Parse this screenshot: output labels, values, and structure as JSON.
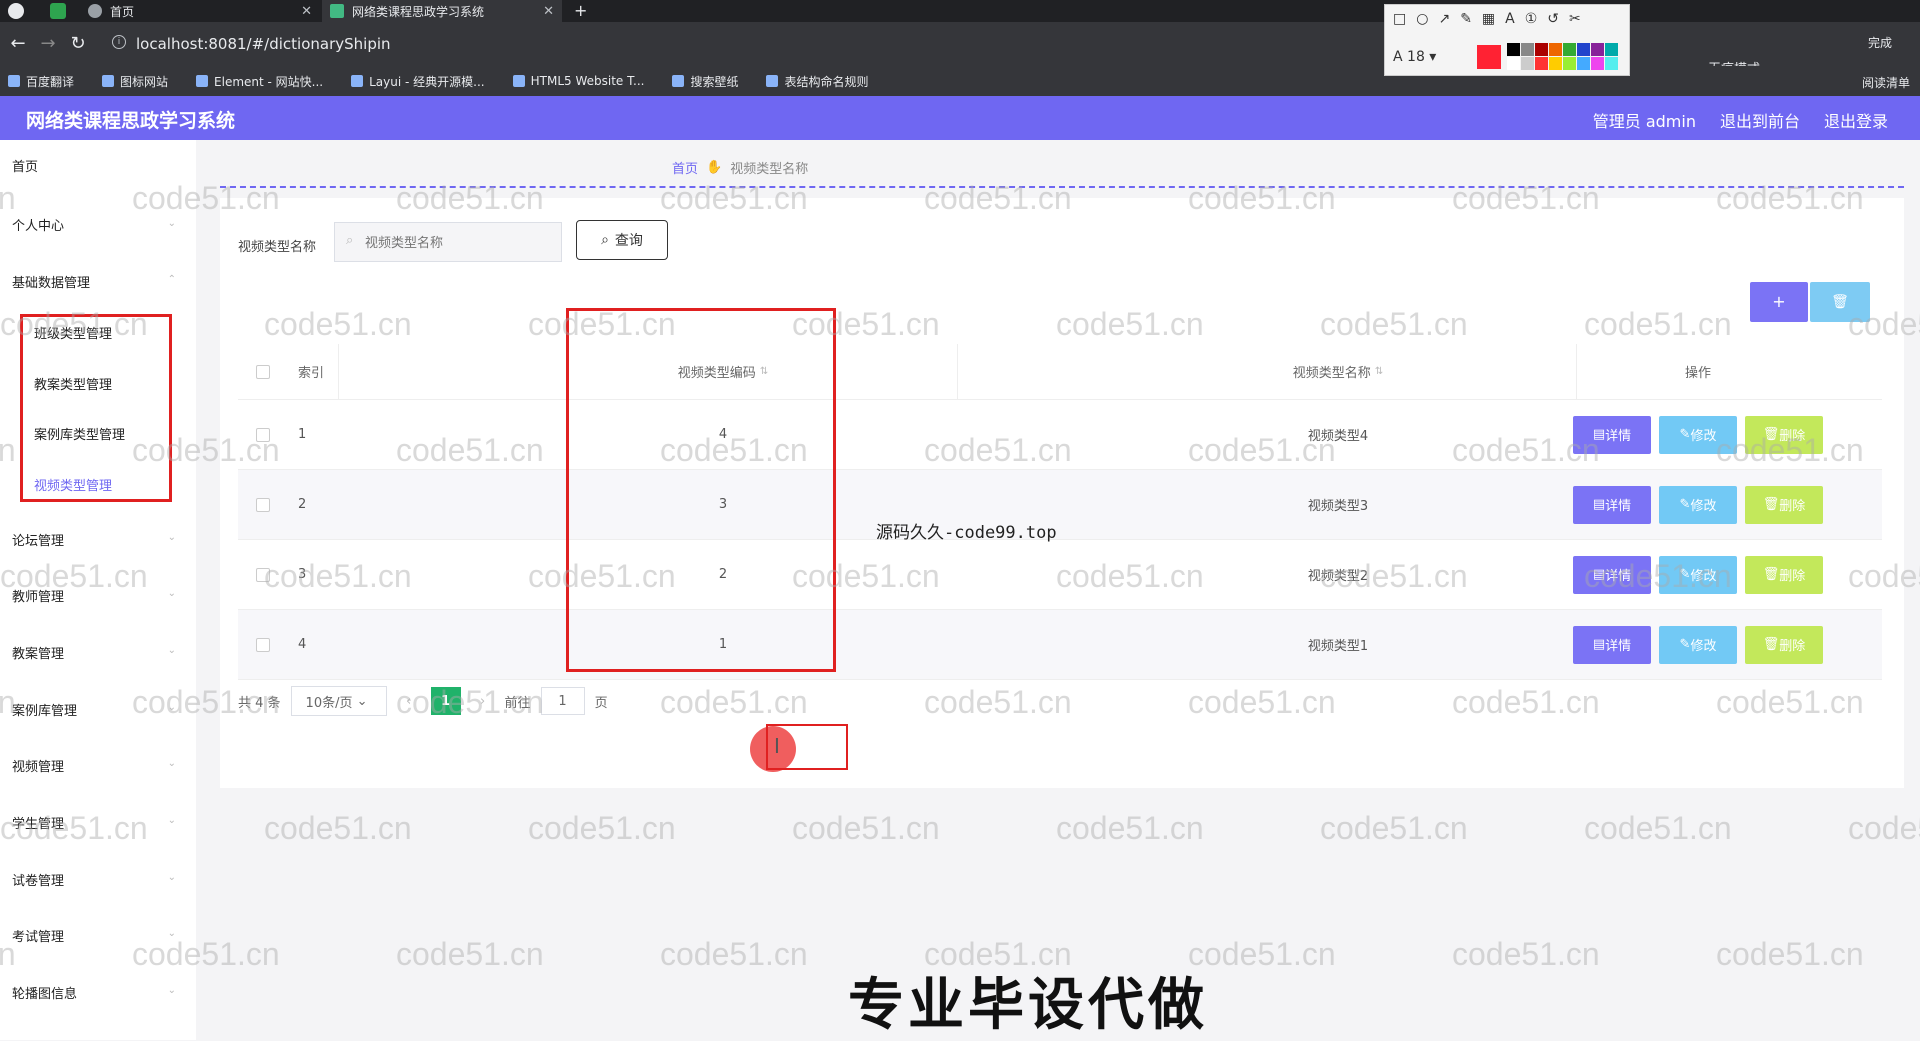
{
  "browser": {
    "tabs": [
      {
        "title": "首页"
      },
      {
        "title": "网络类课程思政学习系统"
      }
    ],
    "url": "localhost:8081/#/dictionaryShipin",
    "bookmarks": [
      "百度翻译",
      "图标网站",
      "Element - 网站快...",
      "Layui - 经典开源模...",
      "HTML5 Website T...",
      "搜索壁纸",
      "表结构命名规则"
    ],
    "reading_list": "阅读清单",
    "incognito": "无痕模式",
    "finish": "完成",
    "font_size": "18"
  },
  "app": {
    "title": "网络类课程思政学习系统",
    "header_links": [
      "管理员 admin",
      "退出到前台",
      "退出登录"
    ]
  },
  "sidebar": {
    "items": [
      {
        "label": "首页"
      },
      {
        "label": "个人中心"
      },
      {
        "label": "基础数据管理"
      },
      {
        "label": "论坛管理"
      },
      {
        "label": "教师管理"
      },
      {
        "label": "教案管理"
      },
      {
        "label": "案例库管理"
      },
      {
        "label": "视频管理"
      },
      {
        "label": "学生管理"
      },
      {
        "label": "试卷管理"
      },
      {
        "label": "考试管理"
      },
      {
        "label": "轮播图信息"
      }
    ],
    "sub_items": [
      {
        "label": "班级类型管理"
      },
      {
        "label": "教案类型管理"
      },
      {
        "label": "案例库类型管理"
      },
      {
        "label": "视频类型管理"
      }
    ]
  },
  "breadcrumb": {
    "home": "首页",
    "current": "视频类型名称"
  },
  "search": {
    "label": "视频类型名称",
    "placeholder": "视频类型名称",
    "button": "查询"
  },
  "actions": {
    "add": "+",
    "delete": "🗑"
  },
  "table": {
    "headers": {
      "index": "索引",
      "code": "视频类型编码",
      "name": "视频类型名称",
      "ops": "操作"
    },
    "rows": [
      {
        "index": "1",
        "code": "4",
        "name": "视频类型4"
      },
      {
        "index": "2",
        "code": "3",
        "name": "视频类型3"
      },
      {
        "index": "3",
        "code": "2",
        "name": "视频类型2"
      },
      {
        "index": "4",
        "code": "1",
        "name": "视频类型1"
      }
    ],
    "op_labels": {
      "detail": "详情",
      "edit": "修改",
      "delete": "删除"
    }
  },
  "pager": {
    "total": "共 4 条",
    "size": "10条/页",
    "current": "1",
    "goto": "前往",
    "goto_value": "1",
    "page_unit": "页"
  },
  "overlays": {
    "watermark": "code51.cn",
    "source": "源码久久-code99.top",
    "banner": "专业毕设代做"
  }
}
